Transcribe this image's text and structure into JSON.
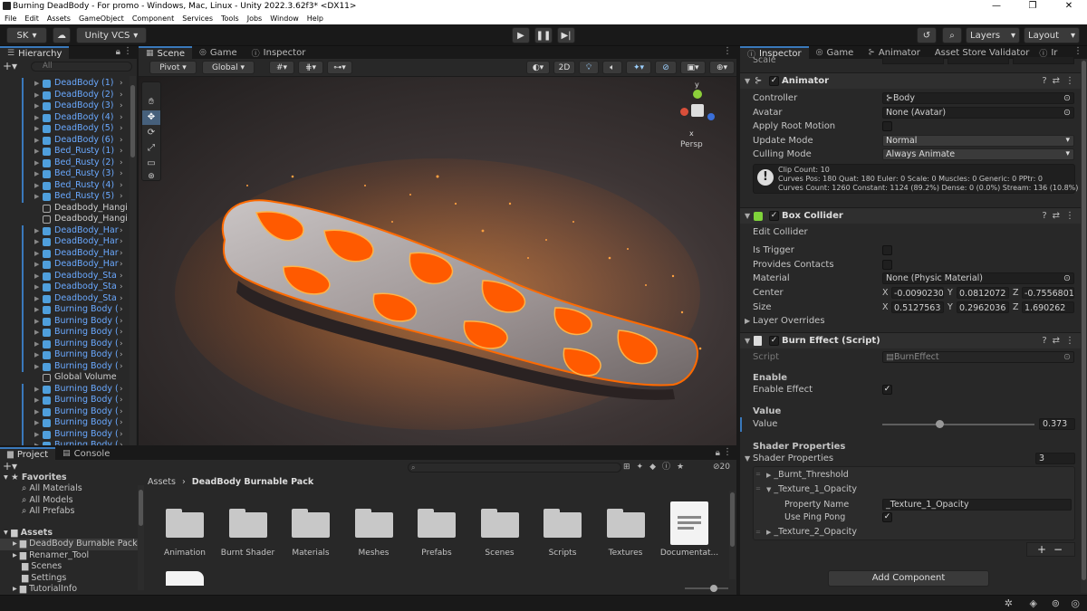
{
  "window": {
    "title": "Burning DeadBody - For promo - Windows, Mac, Linux - Unity 2022.3.62f3* <DX11>",
    "controls": [
      "—",
      "❐",
      "✕"
    ]
  },
  "menu": [
    "File",
    "Edit",
    "Assets",
    "GameObject",
    "Component",
    "Services",
    "Tools",
    "Jobs",
    "Window",
    "Help"
  ],
  "toolbar": {
    "account": "SK",
    "vcs": "Unity VCS",
    "layers": "Layers",
    "layout": "Layout"
  },
  "hierarchy": {
    "tab": "Hierarchy",
    "search_placeholder": "All",
    "items": [
      {
        "label": "DeadBody (1)",
        "blue": true,
        "type": "cube"
      },
      {
        "label": "DeadBody (2)",
        "blue": true,
        "type": "cube"
      },
      {
        "label": "DeadBody (3)",
        "blue": true,
        "type": "cube"
      },
      {
        "label": "DeadBody (4)",
        "blue": true,
        "type": "cube"
      },
      {
        "label": "DeadBody (5)",
        "blue": true,
        "type": "cube"
      },
      {
        "label": "DeadBody (6)",
        "blue": true,
        "type": "cube"
      },
      {
        "label": "Bed_Rusty (1)",
        "blue": true,
        "type": "cube"
      },
      {
        "label": "Bed_Rusty (2)",
        "blue": true,
        "type": "cube"
      },
      {
        "label": "Bed_Rusty (3)",
        "blue": true,
        "type": "cube"
      },
      {
        "label": "Bed_Rusty (4)",
        "blue": true,
        "type": "cube"
      },
      {
        "label": "Bed_Rusty (5)",
        "blue": true,
        "type": "cube"
      },
      {
        "label": "Deadbody_Hangi",
        "blue": false,
        "type": "empty"
      },
      {
        "label": "Deadbody_Hangi",
        "blue": false,
        "type": "empty"
      },
      {
        "label": "DeadBody_Har",
        "blue": true,
        "type": "cube"
      },
      {
        "label": "DeadBody_Har",
        "blue": true,
        "type": "cube"
      },
      {
        "label": "DeadBody_Har",
        "blue": true,
        "type": "cube"
      },
      {
        "label": "DeadBody_Har",
        "blue": true,
        "type": "cube"
      },
      {
        "label": "Deadbody_Sta",
        "blue": true,
        "type": "cube"
      },
      {
        "label": "Deadbody_Sta",
        "blue": true,
        "type": "cube"
      },
      {
        "label": "Deadbody_Sta",
        "blue": true,
        "type": "cube"
      },
      {
        "label": "Burning Body (",
        "blue": true,
        "type": "cube"
      },
      {
        "label": "Burning Body (",
        "blue": true,
        "type": "cube"
      },
      {
        "label": "Burning Body (",
        "blue": true,
        "type": "cube"
      },
      {
        "label": "Burning Body (",
        "blue": true,
        "type": "cube"
      },
      {
        "label": "Burning Body (",
        "blue": true,
        "type": "cube"
      },
      {
        "label": "Burning Body (",
        "blue": true,
        "type": "cube"
      },
      {
        "label": "Global Volume",
        "blue": false,
        "type": "empty"
      },
      {
        "label": "Burning Body (",
        "blue": true,
        "type": "cube"
      },
      {
        "label": "Burning Body (",
        "blue": true,
        "type": "cube"
      },
      {
        "label": "Burning Body (",
        "blue": true,
        "type": "cube"
      },
      {
        "label": "Burning Body (",
        "blue": true,
        "type": "cube"
      },
      {
        "label": "Burning Body (",
        "blue": true,
        "type": "cube"
      },
      {
        "label": "Burning Body (",
        "blue": true,
        "type": "cube"
      }
    ]
  },
  "scene": {
    "tabs": [
      "Scene",
      "Game",
      "Inspector"
    ],
    "pivot": "Pivot",
    "global": "Global",
    "mode_2d": "2D",
    "persp": "Persp",
    "gizmo_axes": [
      "y",
      "x"
    ]
  },
  "project": {
    "tabs": [
      "Project",
      "Console"
    ],
    "favorites": {
      "label": "Favorites",
      "items": [
        "All Materials",
        "All Models",
        "All Prefabs"
      ]
    },
    "assets": {
      "label": "Assets",
      "items": [
        "DeadBody Burnable Pack",
        "Renamer_Tool",
        "Scenes",
        "Settings",
        "TutorialInfo"
      ]
    },
    "breadcrumb": [
      "Assets",
      "DeadBody Burnable Pack"
    ],
    "badge": "20",
    "folders": [
      "Animation",
      "Burnt Shader",
      "Materials",
      "Meshes",
      "Prefabs",
      "Scenes",
      "Scripts",
      "Textures"
    ],
    "doc": "Documentat..."
  },
  "inspector": {
    "tabs": [
      "Inspector",
      "Game",
      "Animator",
      "Asset Store Validator",
      "Ir"
    ],
    "cut_label": "Scale",
    "animator": {
      "title": "Animator",
      "rows": [
        {
          "label": "Controller",
          "value": "Body"
        },
        {
          "label": "Avatar",
          "value": "None (Avatar)"
        }
      ],
      "apply_root_motion": "Apply Root Motion",
      "update_mode_label": "Update Mode",
      "update_mode": "Normal",
      "culling_mode_label": "Culling Mode",
      "culling_mode": "Always Animate",
      "info": [
        "Clip Count: 10",
        "Curves Pos: 180 Quat: 180 Euler: 0 Scale: 0 Muscles: 0 Generic: 0 PPtr: 0",
        "Curves Count: 1260 Constant: 1124 (89.2%) Dense: 0 (0.0%) Stream: 136 (10.8%)"
      ]
    },
    "box_collider": {
      "title": "Box Collider",
      "edit": "Edit Collider",
      "is_trigger": "Is Trigger",
      "provides_contacts": "Provides Contacts",
      "material_label": "Material",
      "material": "None (Physic Material)",
      "center_label": "Center",
      "center": {
        "x": "-0.0090230",
        "y": "0.0812072",
        "z": "-0.7556801"
      },
      "size_label": "Size",
      "size": {
        "x": "0.5127563",
        "y": "0.2962036",
        "z": "1.690262"
      },
      "layer_overrides": "Layer Overrides"
    },
    "burn_effect": {
      "title": "Burn Effect (Script)",
      "script_label": "Script",
      "script": "BurnEffect",
      "enable_header": "Enable",
      "enable_effect": "Enable Effect",
      "value_header": "Value",
      "value_label": "Value",
      "value": "0.373",
      "value_fraction": 0.373,
      "shader_header": "Shader Properties",
      "shader_props_label": "Shader Properties",
      "shader_props_count": "3",
      "burnt_threshold": "_Burnt_Threshold",
      "texture1": "_Texture_1_Opacity",
      "property_name_label": "Property Name",
      "property_name": "_Texture_1_Opacity",
      "use_ping_pong": "Use Ping Pong",
      "texture2": "_Texture_2_Opacity"
    },
    "add_component": "Add Component"
  },
  "colors": {
    "accent": "#3a79bb",
    "blue_text": "#6aa9ff",
    "bg_panel": "#282828",
    "lava": "#ff6a00"
  }
}
